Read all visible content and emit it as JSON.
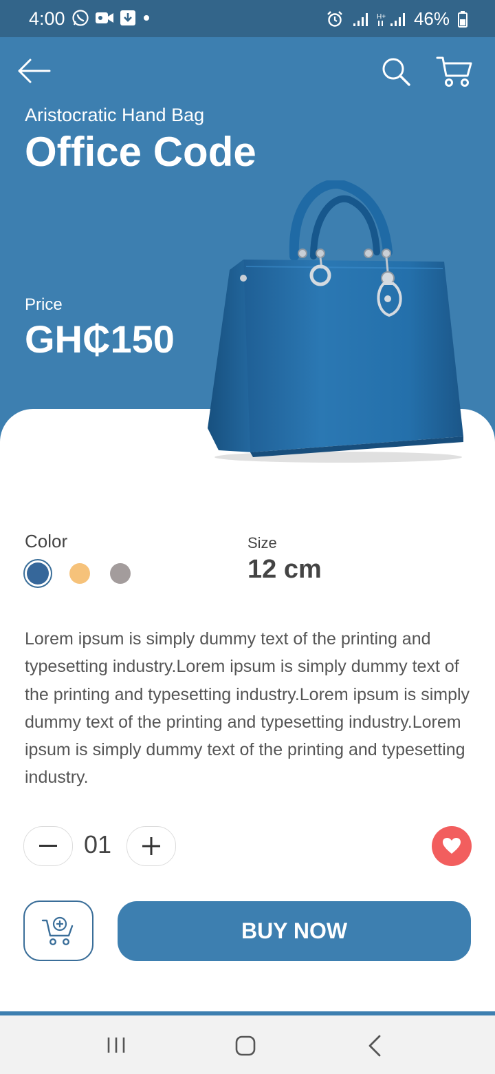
{
  "status_bar": {
    "time": "4:00",
    "battery": "46%",
    "icons": [
      "whatsapp-icon",
      "video-icon",
      "download-icon",
      "dot-icon",
      "alarm-icon",
      "signal-icon",
      "data-signal-icon",
      "battery-icon"
    ]
  },
  "header": {
    "icons": [
      "back-arrow-icon",
      "search-icon",
      "cart-icon"
    ]
  },
  "product": {
    "subtitle": "Aristocratic Hand Bag",
    "title": "Office Code",
    "price_label": "Price",
    "price": "GH₵150",
    "color_label": "Color",
    "colors": [
      "#36679a",
      "#f6c27a",
      "#a39c9c"
    ],
    "selected_color_index": 0,
    "size_label": "Size",
    "size": "12 cm",
    "description": "Lorem ipsum is simply dummy text of the printing and typesetting industry.Lorem ipsum is simply dummy text of the printing and typesetting industry.Lorem ipsum is simply dummy text of the printing and typesetting industry.Lorem ipsum is simply dummy text of the printing and typesetting industry."
  },
  "quantity": {
    "value": "01",
    "minus_icon": "minus-icon",
    "plus_icon": "plus-icon"
  },
  "actions": {
    "favorite_icon": "heart-icon",
    "add_to_cart_icon": "cart-add-icon",
    "buy_label": "BUY NOW"
  },
  "colors": {
    "primary": "#3d7fb0",
    "status_bar": "#33658a",
    "favorite": "#f25e5e"
  },
  "nav": {
    "icons": [
      "recent-apps-icon",
      "home-icon",
      "back-icon"
    ]
  }
}
